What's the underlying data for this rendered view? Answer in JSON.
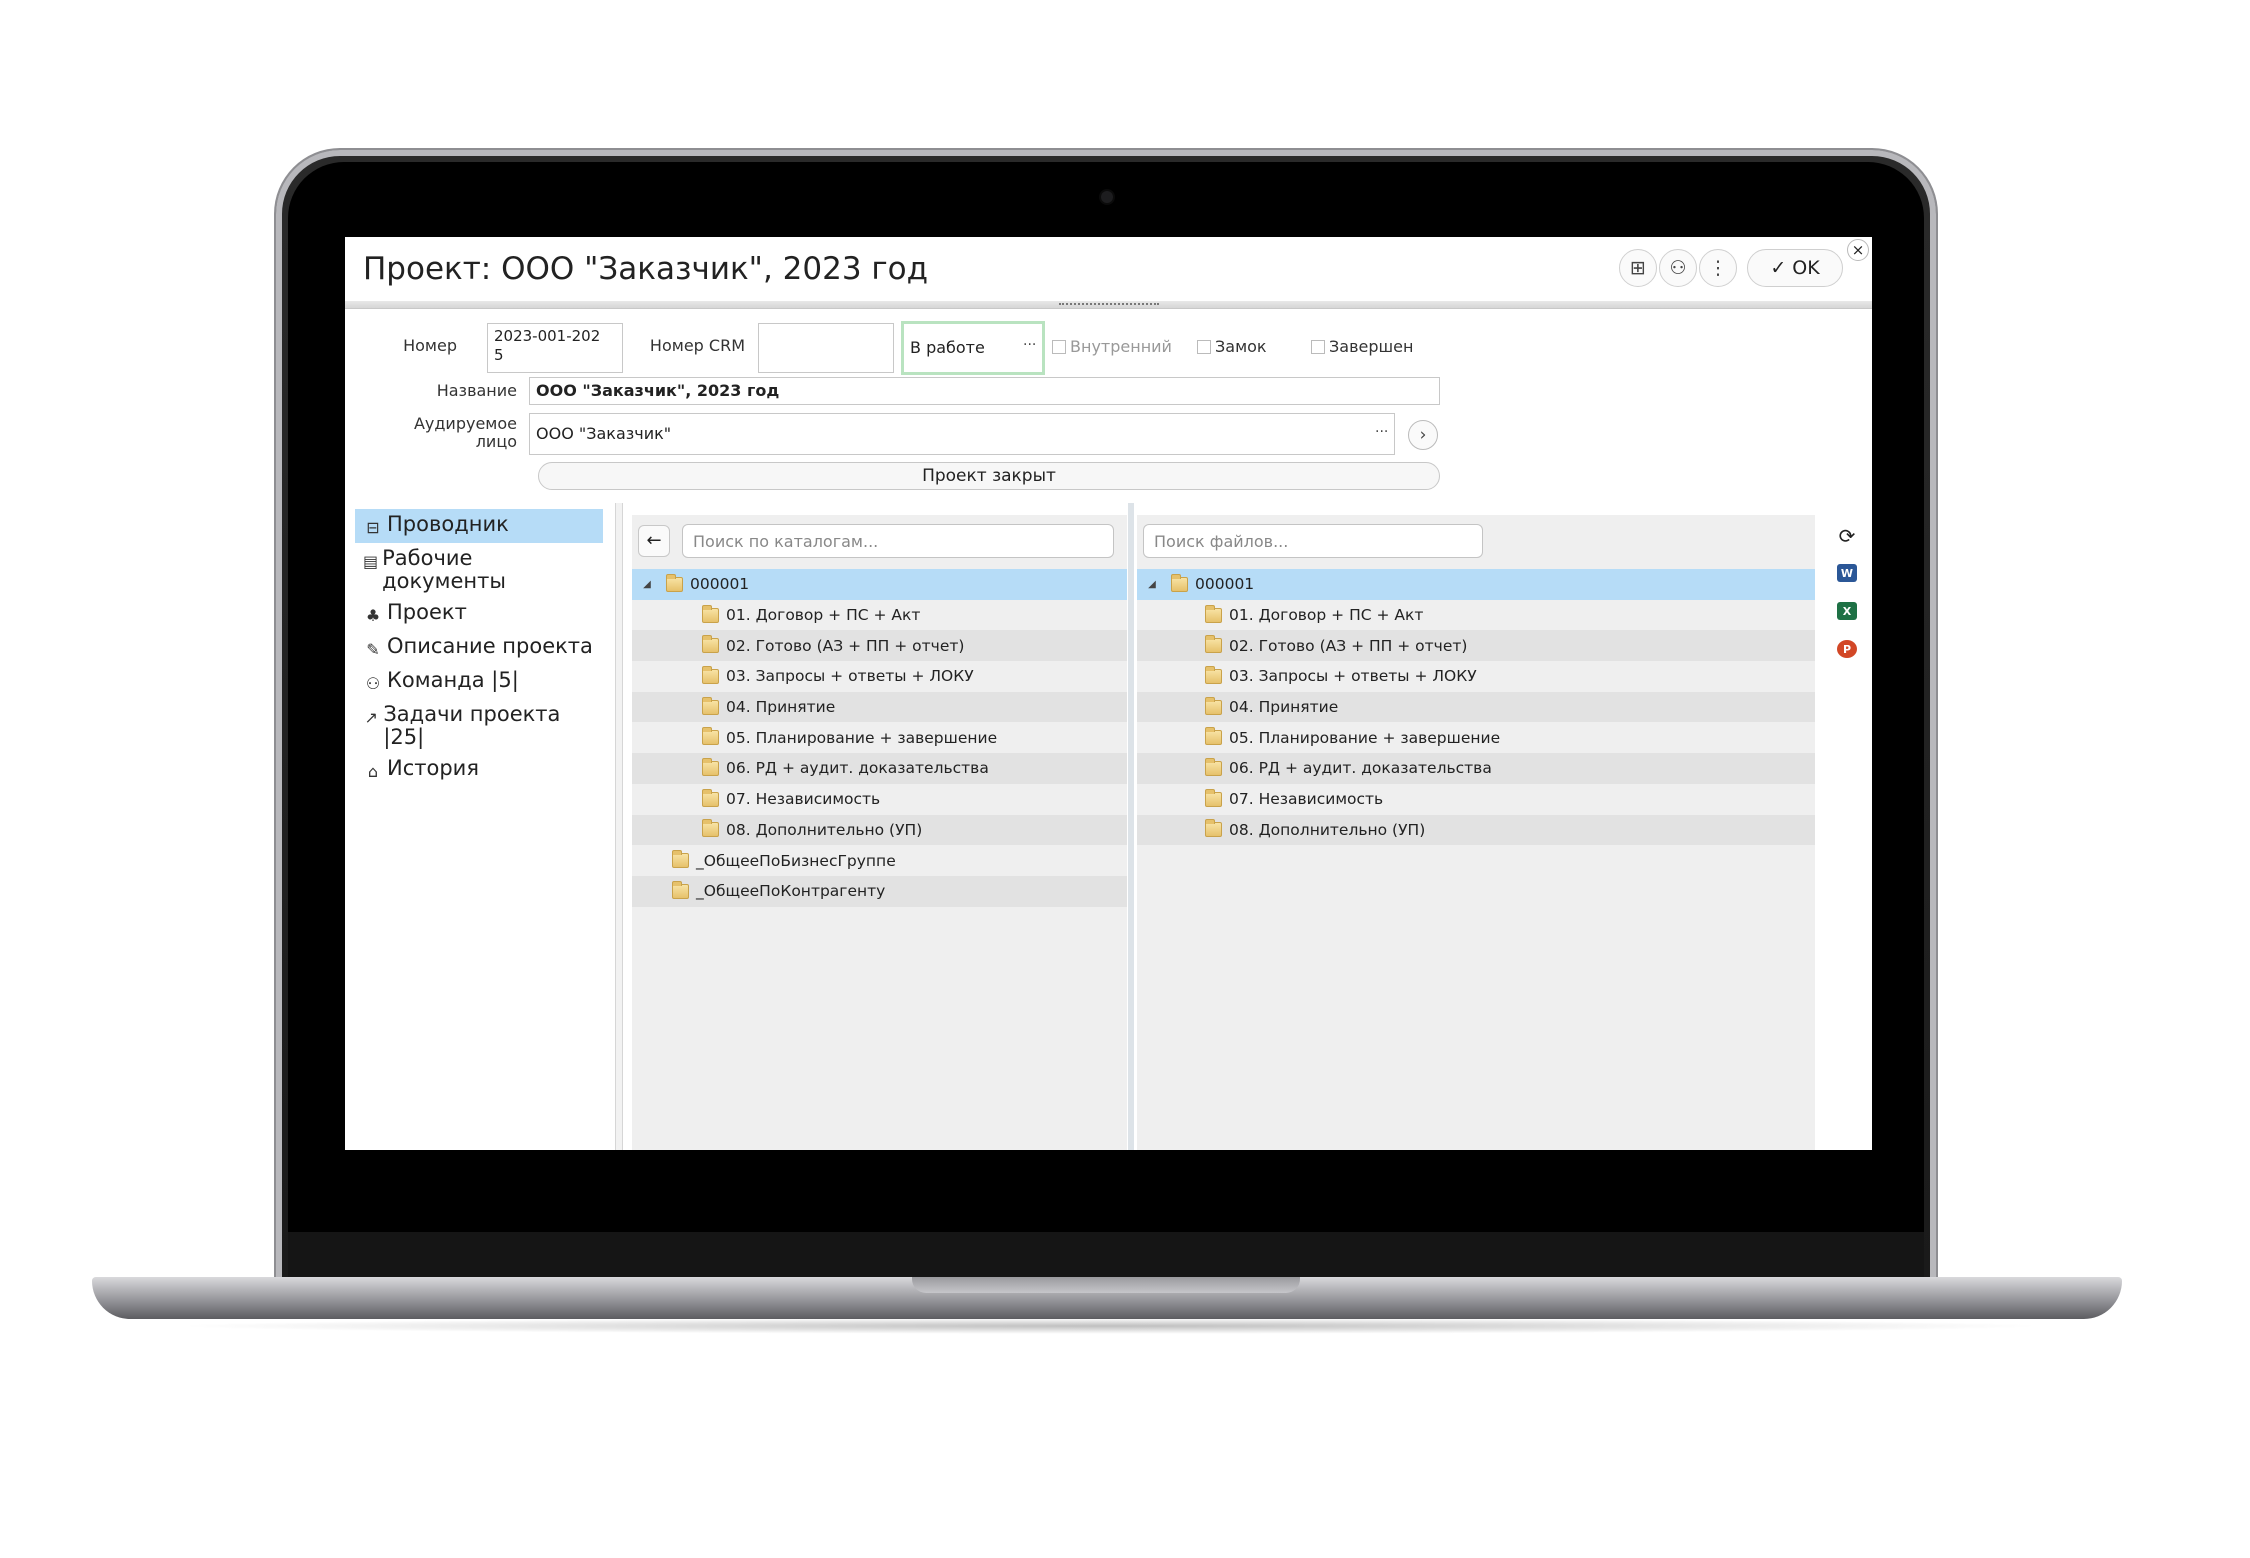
{
  "window": {
    "title": "Проект: ООО \"Заказчик\", 2023 год",
    "ok_label": "OK",
    "close_glyph": "×"
  },
  "form": {
    "number_label": "Номер",
    "number_value_line1": "2023-001-202",
    "number_value_line2": "5",
    "crm_label": "Номер CRM",
    "crm_value": "",
    "status_value": "В работе",
    "internal_label": "Внутренний",
    "lock_label": "Замок",
    "finished_label": "Завершен",
    "name_label": "Название",
    "name_value": "ООО \"Заказчик\", 2023 год",
    "audited_label_line1": "Аудируемое",
    "audited_label_line2": "лицо",
    "audited_value": "ООО \"Заказчик\"",
    "closed_button": "Проект закрыт"
  },
  "sidebar": {
    "items": [
      {
        "label": "Проводник",
        "icon": "tree-icon"
      },
      {
        "label": "Рабочие документы",
        "icon": "document-icon"
      },
      {
        "label": "Проект",
        "icon": "project-icon"
      },
      {
        "label": "Описание проекта",
        "icon": "pencil-icon"
      },
      {
        "label": "Команда |5|",
        "icon": "team-icon"
      },
      {
        "label": "Задачи проекта |25|",
        "icon": "chart-icon"
      },
      {
        "label": "История",
        "icon": "bank-icon"
      }
    ]
  },
  "left_panel": {
    "search_placeholder": "Поиск по каталогам...",
    "root": "000001",
    "children": [
      "01. Договор + ПС + Акт",
      "02. Готово (АЗ + ПП + отчет)",
      "03. Запросы + ответы + ЛОКУ",
      "04. Принятие",
      "05. Планирование + завершение",
      "06. РД + аудит. доказательства",
      "07. Независимость",
      "08. Дополнительно (УП)"
    ],
    "extra": [
      "_ОбщееПоБизнесГруппе",
      "_ОбщееПоКонтрагенту"
    ]
  },
  "right_panel": {
    "search_placeholder": "Поиск файлов...",
    "root": "000001",
    "children": [
      "01. Договор + ПС + Акт",
      "02. Готово (АЗ + ПП + отчет)",
      "03. Запросы + ответы + ЛОКУ",
      "04. Принятие",
      "05. Планирование + завершение",
      "06. РД + аудит. доказательства",
      "07. Независимость",
      "08. Дополнительно (УП)"
    ]
  },
  "tools": {
    "word": "W",
    "excel": "X",
    "powerpoint": "P"
  },
  "colors": {
    "selection": "#b6dcf7",
    "status_border": "#9fd6a8",
    "word": "#2b5797",
    "excel": "#1e7145",
    "powerpoint": "#d24726"
  }
}
